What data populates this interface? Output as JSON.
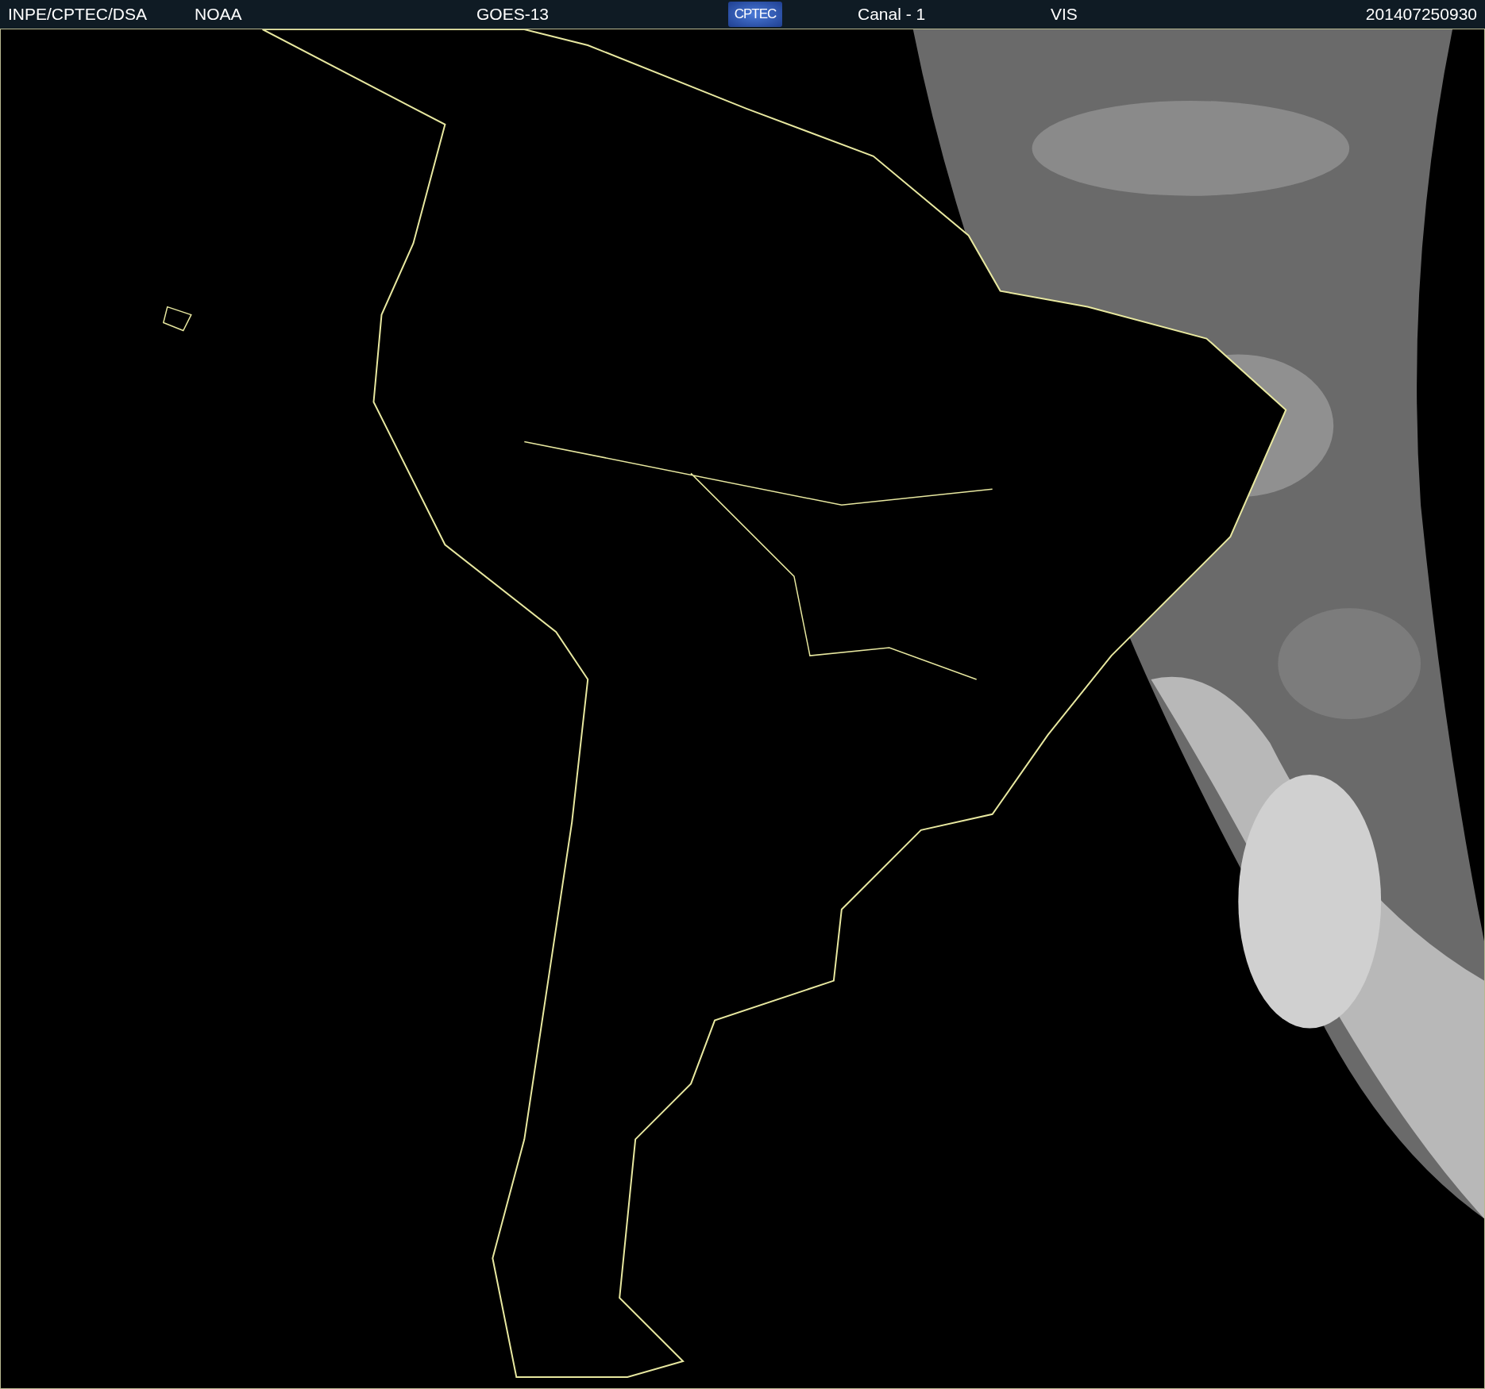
{
  "header": {
    "items": [
      {
        "kind": "text",
        "text": "INPE/CPTEC/DSA"
      },
      {
        "kind": "text",
        "text": "NOAA"
      },
      {
        "kind": "text",
        "text": "GOES-13"
      },
      {
        "kind": "logo",
        "text": "CPTEC"
      },
      {
        "kind": "text",
        "text": "Canal - 1"
      },
      {
        "kind": "text",
        "text": "VIS"
      },
      {
        "kind": "text",
        "text": "201407250930"
      }
    ]
  }
}
